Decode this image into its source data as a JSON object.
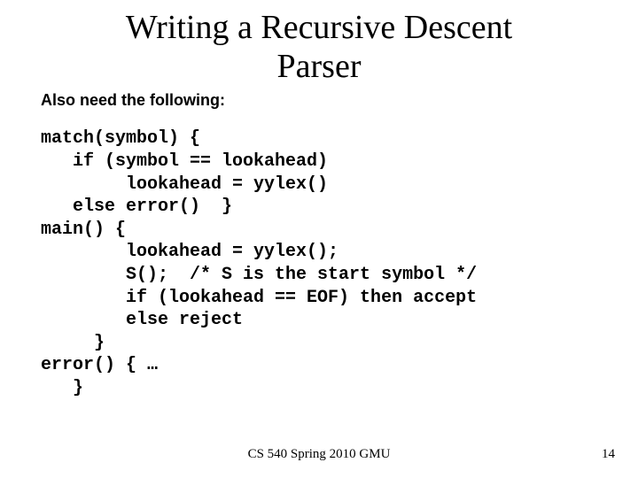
{
  "title_line1": "Writing a Recursive Descent",
  "title_line2": "Parser",
  "subhead": "Also need the following:",
  "code": "match(symbol) {\n   if (symbol == lookahead)\n        lookahead = yylex()\n   else error()  }\nmain() {\n        lookahead = yylex();\n        S();  /* S is the start symbol */\n        if (lookahead == EOF) then accept\n        else reject\n     }\nerror() { …\n   }",
  "footer_center": "CS 540 Spring 2010 GMU",
  "footer_right": "14"
}
